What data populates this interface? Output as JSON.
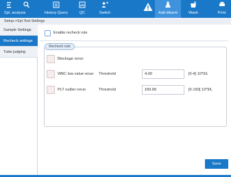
{
  "topbar": {
    "items": [
      {
        "label": "Spl. analysis",
        "icon": "menu-search-icon"
      },
      {
        "label": "History Query",
        "icon": "history-icon"
      },
      {
        "label": "QC",
        "icon": "qc-icon"
      },
      {
        "label": "Switch",
        "icon": "switch-icon"
      },
      {
        "label": "Add diluent",
        "icon": "flask-icon"
      },
      {
        "label": "Wash",
        "icon": "wash-icon"
      },
      {
        "label": "Print",
        "icon": "print-icon"
      }
    ]
  },
  "breadcrumb": "Setup->Spl.Test Settings",
  "sidebar": {
    "items": [
      {
        "label": "Sample Settings"
      },
      {
        "label": "Recheck settings"
      },
      {
        "label": "Tube judging"
      }
    ]
  },
  "content": {
    "enable_label": "Enable recheck rule",
    "group_title": "Recheck rule",
    "rows": [
      {
        "label": "Blockage rerun"
      },
      {
        "label": "WBC low value rerun",
        "threshold_label": "Threshold",
        "value": "4.00",
        "range": "[0-4] 10*9/L"
      },
      {
        "label": "PLT outlier rerun",
        "threshold_label": "Threshold",
        "value": "150.00",
        "range": "[0-150] 10*9/L"
      }
    ],
    "save_label": "Save"
  },
  "colors": {
    "accent": "#1a78c8",
    "active_tab": "#3f93dd"
  }
}
